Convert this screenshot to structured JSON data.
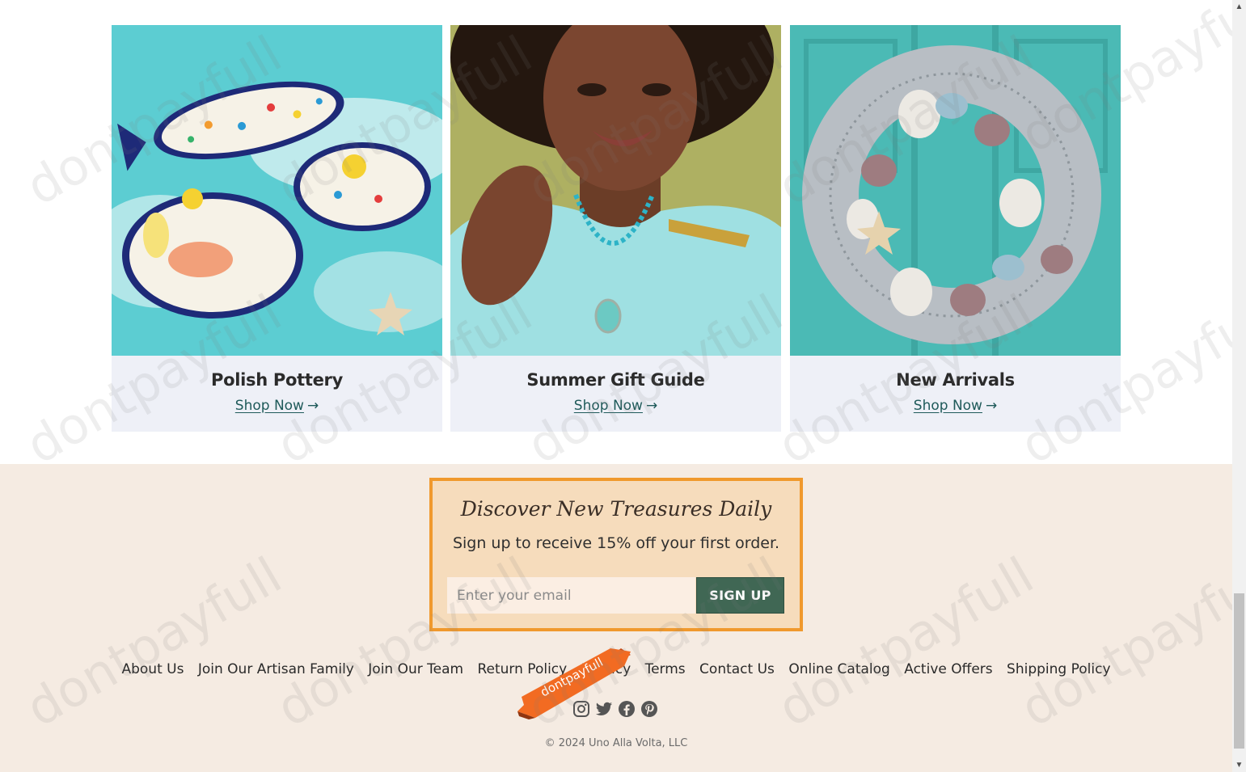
{
  "cards": [
    {
      "title": "Polish Pottery",
      "link": "Shop Now",
      "arrow": "→",
      "image": "polish-pottery-fish-dishes"
    },
    {
      "title": "Summer Gift Guide",
      "link": "Shop Now",
      "arrow": "→",
      "image": "woman-wearing-turquoise-necklace"
    },
    {
      "title": "New Arrivals",
      "link": "Shop Now",
      "arrow": "→",
      "image": "seashell-wreath-on-teal-door"
    }
  ],
  "signup": {
    "title": "Discover New Treasures Daily",
    "subtitle": "Sign up to receive 15% off your first order.",
    "email_placeholder": "Enter your email",
    "button_label": "SIGN UP"
  },
  "footer_links": [
    "About Us",
    "Join Our Artisan Family",
    "Join Our Team",
    "Return Policy",
    "Privacy",
    "Terms",
    "Contact Us",
    "Online Catalog",
    "Active Offers",
    "Shipping Policy"
  ],
  "social_icons": [
    "instagram-icon",
    "twitter-icon",
    "facebook-icon",
    "pinterest-icon"
  ],
  "copyright": "© 2024 Uno Alla Volta, LLC",
  "ribbon_text": "dontpayfull",
  "watermark": "dontpayfull",
  "colors": {
    "accent_orange": "#f0992d",
    "button_green": "#406754",
    "footer_bg": "#f5ebe2",
    "card_bg": "#eef0f7",
    "link_color": "#1f5a5a"
  }
}
